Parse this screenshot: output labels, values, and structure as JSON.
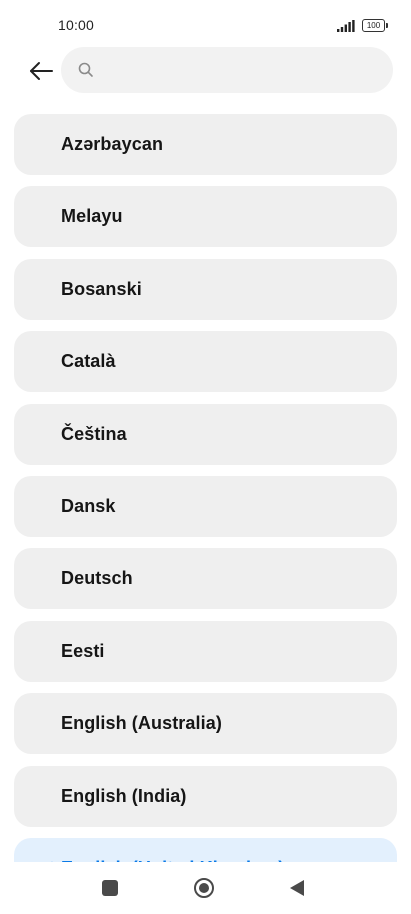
{
  "status_bar": {
    "time": "10:00",
    "battery_level": "100",
    "signal_icon": "signal-bars-icon",
    "battery_icon": "battery-icon"
  },
  "header": {
    "back_icon": "arrow-left-icon",
    "search": {
      "value": "",
      "placeholder": "",
      "icon": "search-icon"
    }
  },
  "languages": [
    {
      "label": "Azərbaycan",
      "selected": false
    },
    {
      "label": "Melayu",
      "selected": false
    },
    {
      "label": "Bosanski",
      "selected": false
    },
    {
      "label": "Català",
      "selected": false
    },
    {
      "label": "Čeština",
      "selected": false
    },
    {
      "label": "Dansk",
      "selected": false
    },
    {
      "label": "Deutsch",
      "selected": false
    },
    {
      "label": "Eesti",
      "selected": false
    },
    {
      "label": "English (Australia)",
      "selected": false
    },
    {
      "label": "English (India)",
      "selected": false
    },
    {
      "label": "English (United Kingdom)",
      "selected": true
    }
  ],
  "colors": {
    "item_background": "#efefef",
    "selected_background": "#e3f0fd",
    "selected_text": "#0b7ae6",
    "search_background": "#f2f2f2"
  },
  "nav_bar": {
    "recents_icon": "square-recents-icon",
    "home_icon": "circle-home-icon",
    "back_icon": "triangle-back-icon"
  }
}
